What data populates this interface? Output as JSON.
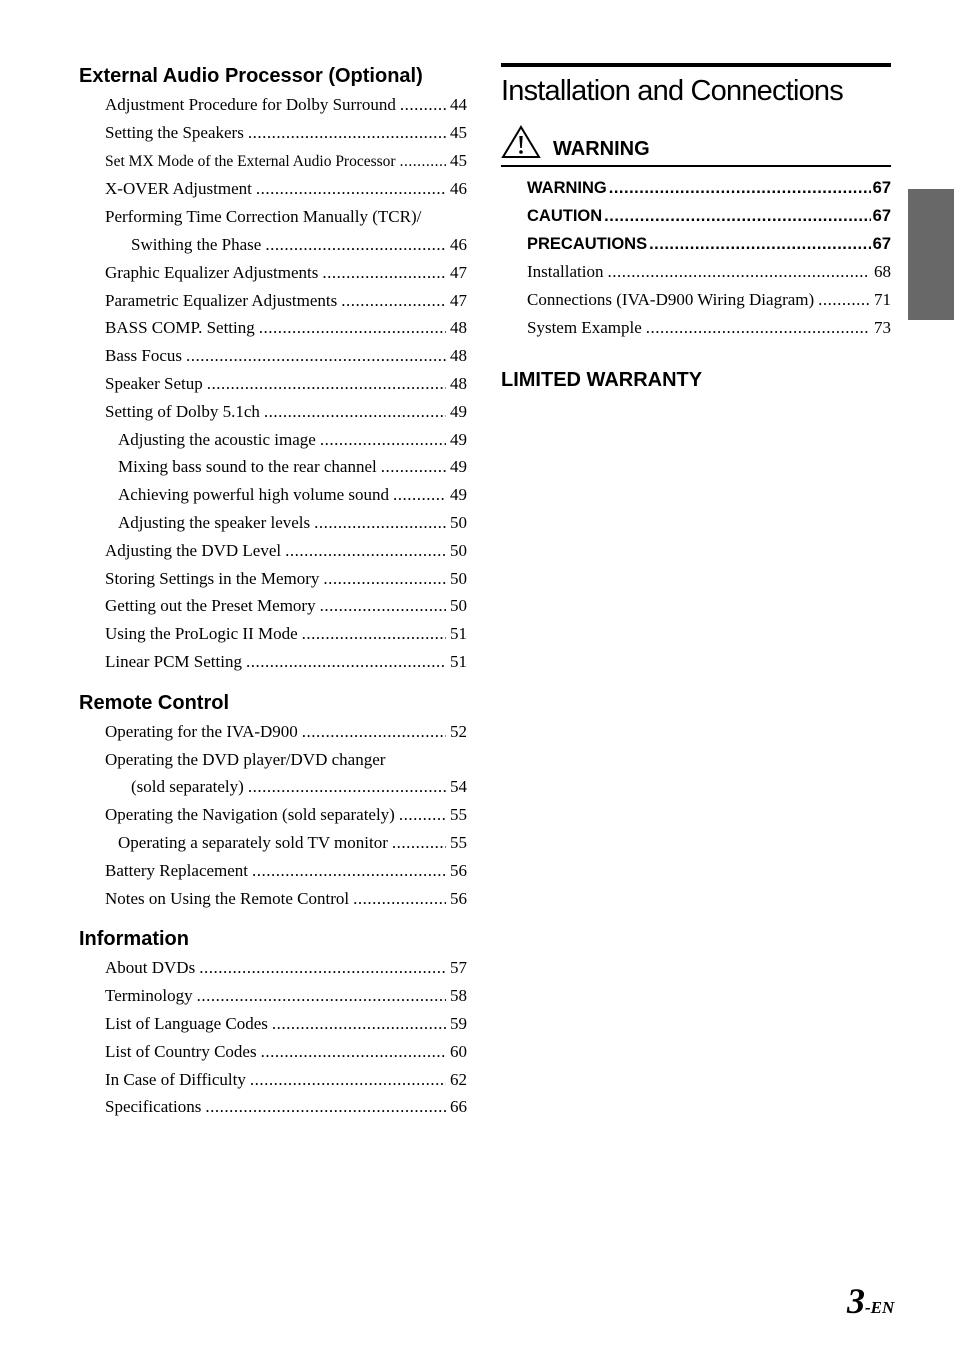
{
  "left_column": {
    "sections": [
      {
        "heading": "External Audio Processor (Optional)",
        "entries": [
          {
            "label": "Adjustment Procedure for Dolby Surround",
            "page": "44",
            "level": 1
          },
          {
            "label": "Setting the Speakers",
            "page": "45",
            "level": 1
          },
          {
            "label": "Set MX Mode of the External Audio Processor",
            "page": "45",
            "level": 1
          },
          {
            "label": "X-OVER Adjustment",
            "page": "46",
            "level": 1
          },
          {
            "label": "Performing Time Correction Manually (TCR)/",
            "page": "",
            "level": 1
          },
          {
            "label": "Swithing the Phase",
            "page": "46",
            "level": 1
          },
          {
            "label": "Graphic Equalizer Adjustments",
            "page": "47",
            "level": 1
          },
          {
            "label": "Parametric Equalizer Adjustments",
            "page": "47",
            "level": 1
          },
          {
            "label": "BASS COMP. Setting",
            "page": "48",
            "level": 1
          },
          {
            "label": "Bass Focus",
            "page": "48",
            "level": 1
          },
          {
            "label": "Speaker Setup",
            "page": "48",
            "level": 1
          },
          {
            "label": "Setting of Dolby 5.1ch",
            "page": "49",
            "level": 1
          },
          {
            "label": "Adjusting the acoustic image",
            "page": "49",
            "level": 2
          },
          {
            "label": "Mixing bass sound to the rear channel",
            "page": "49",
            "level": 2
          },
          {
            "label": "Achieving powerful high volume sound",
            "page": "49",
            "level": 2
          },
          {
            "label": "Adjusting the speaker levels",
            "page": "50",
            "level": 2
          },
          {
            "label": "Adjusting the DVD Level",
            "page": "50",
            "level": 1
          },
          {
            "label": "Storing Settings in the Memory",
            "page": "50",
            "level": 1
          },
          {
            "label": "Getting out the Preset Memory",
            "page": "50",
            "level": 1
          },
          {
            "label": "Using the ProLogic II Mode",
            "page": "51",
            "level": 1
          },
          {
            "label": "Linear PCM Setting",
            "page": "51",
            "level": 1
          }
        ]
      },
      {
        "heading": "Remote Control",
        "entries": [
          {
            "label": "Operating for the IVA-D900",
            "page": "52",
            "level": 1
          },
          {
            "label": "Operating the DVD player/DVD changer",
            "page": "",
            "level": 1
          },
          {
            "label": "(sold separately)",
            "page": "54",
            "level": 1
          },
          {
            "label": "Operating the Navigation (sold separately)",
            "page": "55",
            "level": 1
          },
          {
            "label": "Operating a separately sold TV monitor",
            "page": "55",
            "level": 2
          },
          {
            "label": "Battery Replacement",
            "page": "56",
            "level": 1
          },
          {
            "label": "Notes on Using the Remote Control",
            "page": "56",
            "level": 1
          }
        ]
      },
      {
        "heading": "Information",
        "entries": [
          {
            "label": "About DVDs",
            "page": "57",
            "level": 1
          },
          {
            "label": "Terminology",
            "page": "58",
            "level": 1
          },
          {
            "label": "List of Language Codes",
            "page": "59",
            "level": 1
          },
          {
            "label": "List of Country Codes",
            "page": "60",
            "level": 1
          },
          {
            "label": "In Case of Difficulty",
            "page": "62",
            "level": 1
          },
          {
            "label": "Specifications",
            "page": "66",
            "level": 1
          }
        ]
      }
    ]
  },
  "right_column": {
    "title": "Installation and Connections",
    "warning_heading": "WARNING",
    "warning_icon": "warning-triangle-icon",
    "entries": [
      {
        "label": "WARNING",
        "page": "67",
        "bold": true
      },
      {
        "label": "CAUTION",
        "page": "67",
        "bold": true
      },
      {
        "label": "PRECAUTIONS",
        "page": "67",
        "bold": true
      },
      {
        "label": "Installation",
        "page": "68",
        "bold": false
      },
      {
        "label": "Connections (IVA-D900 Wiring Diagram)",
        "page": "71",
        "bold": false
      },
      {
        "label": "System Example",
        "page": "73",
        "bold": false
      }
    ],
    "warranty_heading": "LIMITED WARRANTY"
  },
  "footer": {
    "page_number": "3",
    "page_suffix": "-EN"
  },
  "colors": {
    "side_tab": "#686868",
    "text": "#000000"
  }
}
